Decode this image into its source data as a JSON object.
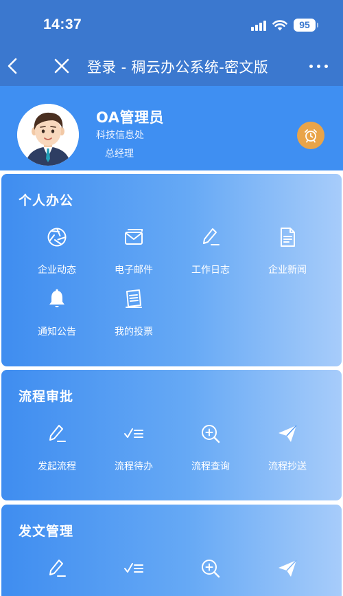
{
  "status_bar": {
    "time": "14:37",
    "battery": "95"
  },
  "nav": {
    "title": "登录 - 稠云办公系统-密文版"
  },
  "profile": {
    "name": "OA管理员",
    "department": "科技信息处",
    "position": "总经理"
  },
  "sections": [
    {
      "title": "个人办公",
      "items": [
        {
          "label": "企业动态",
          "icon": "aperture-icon"
        },
        {
          "label": "电子邮件",
          "icon": "mail-icon"
        },
        {
          "label": "工作日志",
          "icon": "pencil-icon"
        },
        {
          "label": "企业新闻",
          "icon": "document-icon"
        },
        {
          "label": "通知公告",
          "icon": "bell-icon"
        },
        {
          "label": "我的投票",
          "icon": "clipboard-icon"
        }
      ]
    },
    {
      "title": "流程审批",
      "items": [
        {
          "label": "发起流程",
          "icon": "pencil-icon"
        },
        {
          "label": "流程待办",
          "icon": "checklist-icon"
        },
        {
          "label": "流程查询",
          "icon": "search-plus-icon"
        },
        {
          "label": "流程抄送",
          "icon": "paper-plane-icon"
        }
      ]
    },
    {
      "title": "发文管理",
      "items": [
        {
          "icon": "pencil-icon"
        },
        {
          "icon": "checklist-icon"
        },
        {
          "icon": "search-plus-icon"
        },
        {
          "icon": "paper-plane-icon"
        }
      ]
    }
  ],
  "colors": {
    "nav_bar": "#3b78cf",
    "profile_bg": "#3f8ff2",
    "card_gradient_start": "#3f8df0",
    "card_gradient_end": "#a7ccfa",
    "alarm_button": "#e9a449"
  }
}
